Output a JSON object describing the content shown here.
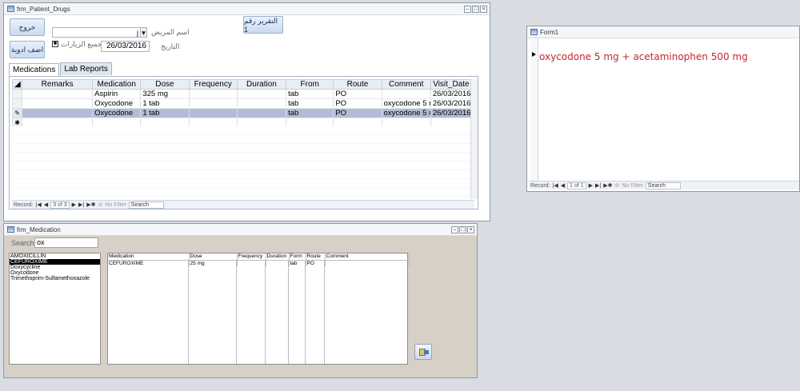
{
  "patient_drugs": {
    "title": "frm_Patient_Drugs",
    "exit_btn": "خروج",
    "add_med_btn": "اضف ادوية",
    "report_btn": "التقرير رقم 1",
    "patient_name_label": "اسم المريض",
    "patient_name_value": "j",
    "all_visits_label": "جميع الزيارات",
    "date_label": "التاريخ",
    "date_value": "26/03/2016",
    "tabs": [
      "Medications",
      "Lab Reports"
    ],
    "columns": [
      "Remarks",
      "Medication",
      "Dose",
      "Frequency",
      "Duration",
      "From",
      "Route",
      "Comment",
      "Visit_Date"
    ],
    "rows": [
      {
        "selector": "",
        "remarks": "",
        "medication": "Aspirin",
        "dose": "325 mg",
        "frequency": "",
        "duration": "",
        "from": "tab",
        "route": "PO",
        "comment": "",
        "visit_date": "26/03/2016"
      },
      {
        "selector": "",
        "remarks": "",
        "medication": "Oxycodone",
        "dose": "1 tab",
        "frequency": "",
        "duration": "",
        "from": "tab",
        "route": "PO",
        "comment": "oxycodone 5 r",
        "visit_date": "26/03/2016"
      },
      {
        "selector": "✎",
        "remarks": "",
        "medication": "Oxycodone",
        "dose": "1 tab",
        "frequency": "",
        "duration": "",
        "from": "tab",
        "route": "PO",
        "comment": "oxycodone 5 r",
        "visit_date": "26/03/2016"
      },
      {
        "selector": "✱",
        "remarks": "",
        "medication": "",
        "dose": "",
        "frequency": "",
        "duration": "",
        "from": "",
        "route": "",
        "comment": "",
        "visit_date": ""
      }
    ],
    "nav": {
      "record_label": "Record:",
      "position": "3 of 3",
      "filter": "No Filter",
      "search": "Search"
    }
  },
  "form1": {
    "title": "Form1",
    "text": "oxycodone 5 mg + acetaminophen 500 mg",
    "nav": {
      "record_label": "Record:",
      "position": "1 of 1",
      "filter": "No Filter",
      "search": "Search"
    }
  },
  "medication": {
    "title": "frm_Medication",
    "search_label": "Search",
    "search_value": "ox",
    "list": [
      "AMOXICILLIN",
      "CEFUROXIME",
      "Doxycycline",
      "Oxycodone",
      "Trimethoprim-Sulfamethoxazole"
    ],
    "selected_index": 1,
    "columns": [
      "Medication",
      "Dose",
      "Frequency",
      "Duration",
      "Form",
      "Route",
      "Comment"
    ],
    "rows": [
      {
        "medication": "CEFUROXIME",
        "dose": "25 mg",
        "frequency": "",
        "duration": "",
        "form": "tab",
        "route": "PO",
        "comment": ""
      }
    ]
  },
  "colors": {
    "current_row": "#b3bcd6",
    "form1_text": "#c0282d"
  }
}
